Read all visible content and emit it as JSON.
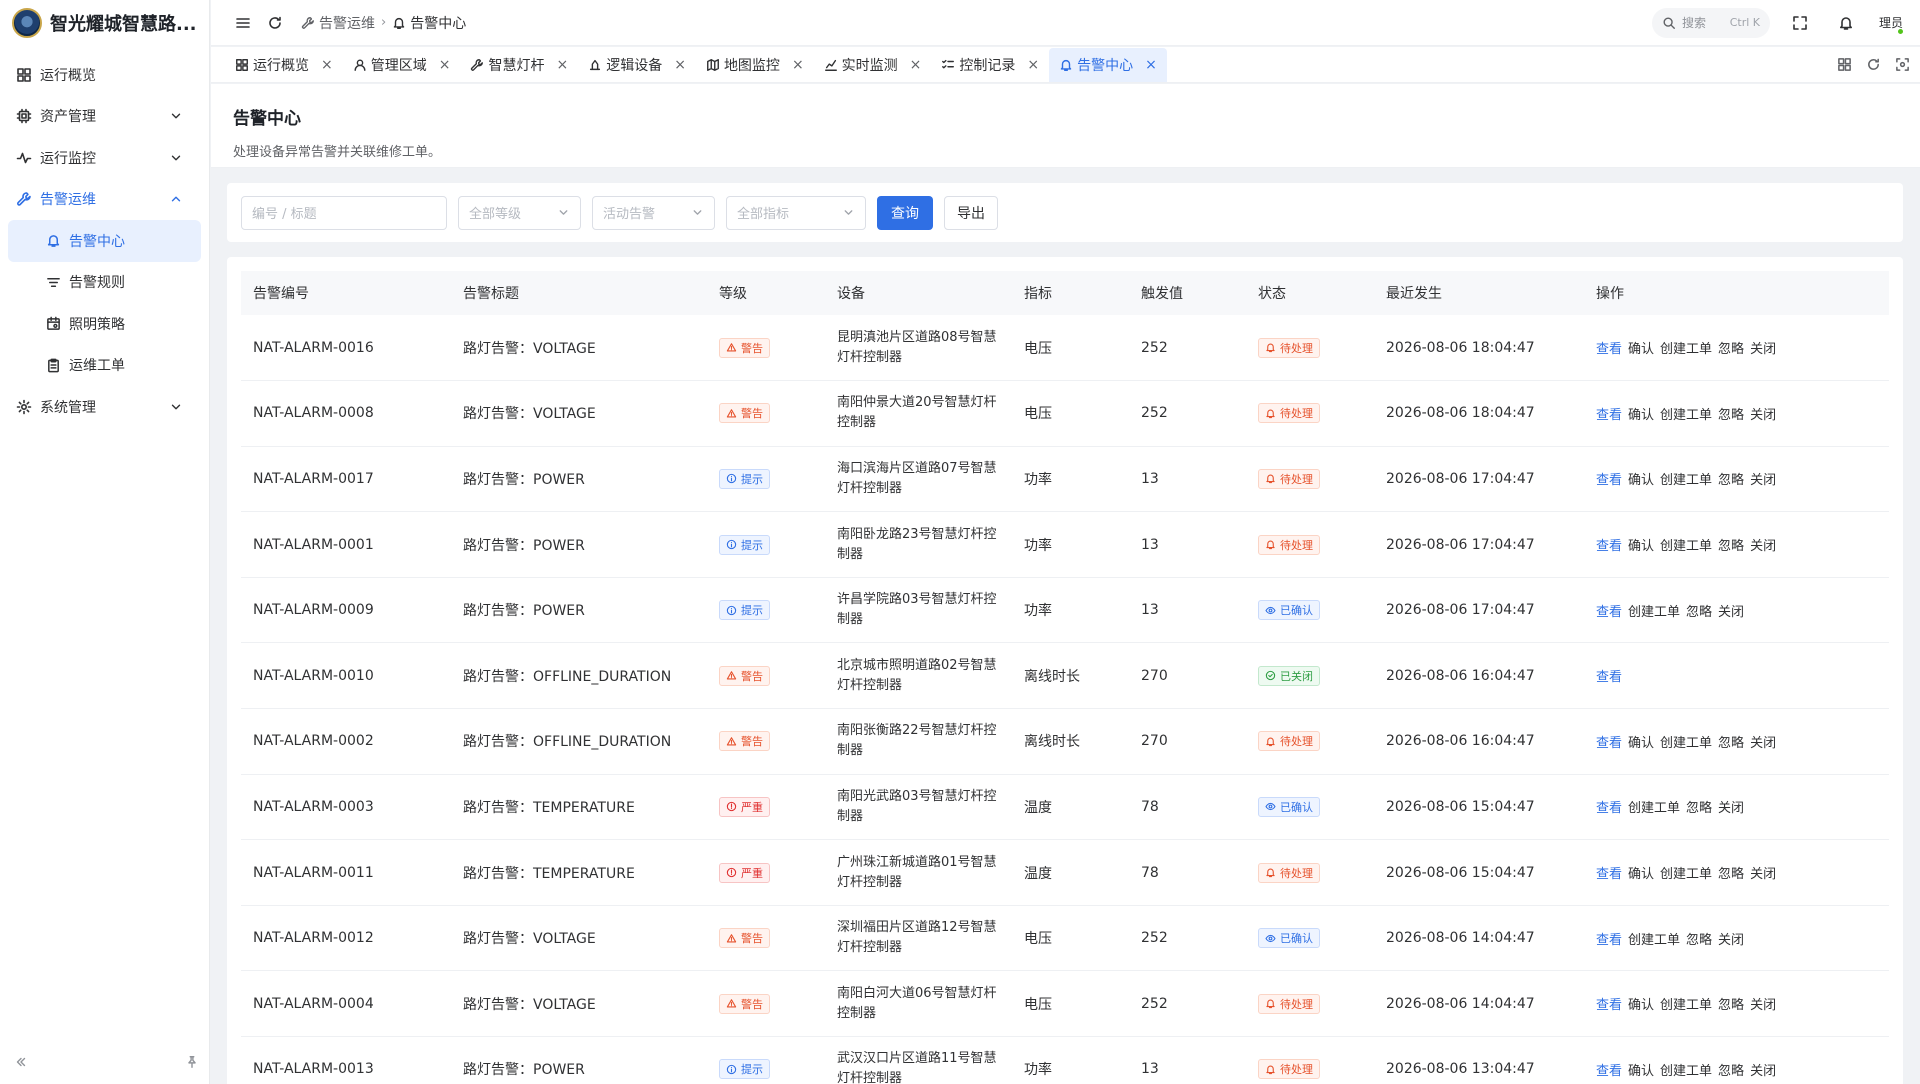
{
  "app": {
    "title": "智光耀城智慧路..."
  },
  "sidebar": {
    "items": [
      {
        "label": "运行概览",
        "icon": "grid-icon"
      },
      {
        "label": "资产管理",
        "icon": "cpu-icon"
      },
      {
        "label": "运行监控",
        "icon": "activity-icon"
      },
      {
        "label": "告警运维",
        "icon": "wrench-icon"
      },
      {
        "label": "系统管理",
        "icon": "settings-icon"
      }
    ],
    "subitems": [
      {
        "label": "告警中心",
        "icon": "bell-icon"
      },
      {
        "label": "告警规则",
        "icon": "filter-icon"
      },
      {
        "label": "照明策略",
        "icon": "calendar-icon"
      },
      {
        "label": "运维工单",
        "icon": "clipboard-icon"
      }
    ]
  },
  "header": {
    "breadcrumb": [
      "告警运维",
      "告警中心"
    ],
    "search_label": "搜索",
    "search_kbd": "Ctrl K",
    "user": "理员"
  },
  "tabs": [
    "运行概览",
    "管理区域",
    "智慧灯杆",
    "逻辑设备",
    "地图监控",
    "实时监测",
    "控制记录",
    "告警中心"
  ],
  "page": {
    "title": "告警中心",
    "subtitle": "处理设备异常告警并关联维修工单。"
  },
  "filters": {
    "keyword_placeholder": "编号 / 标题",
    "level": "全部等级",
    "status": "活动告警",
    "metric": "全部指标",
    "query_label": "查询",
    "export_label": "导出"
  },
  "table": {
    "columns": [
      "告警编号",
      "告警标题",
      "等级",
      "设备",
      "指标",
      "触发值",
      "状态",
      "最近发生",
      "操作"
    ],
    "rows": [
      {
        "id": "NAT-ALARM-0016",
        "title": "路灯告警：VOLTAGE",
        "level": "警告",
        "level_type": "warn",
        "device": "昆明滇池片区道路08号智慧灯杆控制器",
        "metric": "电压",
        "value": "252",
        "status": "待处理",
        "status_type": "pend",
        "time": "2026-08-06 18:04:47",
        "ops": [
          "查看",
          "确认",
          "创建工单",
          "忽略",
          "关闭"
        ]
      },
      {
        "id": "NAT-ALARM-0008",
        "title": "路灯告警：VOLTAGE",
        "level": "警告",
        "level_type": "warn",
        "device": "南阳仲景大道20号智慧灯杆控制器",
        "metric": "电压",
        "value": "252",
        "status": "待处理",
        "status_type": "pend",
        "time": "2026-08-06 18:04:47",
        "ops": [
          "查看",
          "确认",
          "创建工单",
          "忽略",
          "关闭"
        ]
      },
      {
        "id": "NAT-ALARM-0017",
        "title": "路灯告警：POWER",
        "level": "提示",
        "level_type": "info",
        "device": "海口滨海片区道路07号智慧灯杆控制器",
        "metric": "功率",
        "value": "13",
        "status": "待处理",
        "status_type": "pend",
        "time": "2026-08-06 17:04:47",
        "ops": [
          "查看",
          "确认",
          "创建工单",
          "忽略",
          "关闭"
        ]
      },
      {
        "id": "NAT-ALARM-0001",
        "title": "路灯告警：POWER",
        "level": "提示",
        "level_type": "info",
        "device": "南阳卧龙路23号智慧灯杆控制器",
        "metric": "功率",
        "value": "13",
        "status": "待处理",
        "status_type": "pend",
        "time": "2026-08-06 17:04:47",
        "ops": [
          "查看",
          "确认",
          "创建工单",
          "忽略",
          "关闭"
        ]
      },
      {
        "id": "NAT-ALARM-0009",
        "title": "路灯告警：POWER",
        "level": "提示",
        "level_type": "info",
        "device": "许昌学院路03号智慧灯杆控制器",
        "metric": "功率",
        "value": "13",
        "status": "已确认",
        "status_type": "ack",
        "time": "2026-08-06 17:04:47",
        "ops": [
          "查看",
          "创建工单",
          "忽略",
          "关闭"
        ]
      },
      {
        "id": "NAT-ALARM-0010",
        "title": "路灯告警：OFFLINE_DURATION",
        "level": "警告",
        "level_type": "warn",
        "device": "北京城市照明道路02号智慧灯杆控制器",
        "metric": "离线时长",
        "value": "270",
        "status": "已关闭",
        "status_type": "closed",
        "time": "2026-08-06 16:04:47",
        "ops": [
          "查看"
        ]
      },
      {
        "id": "NAT-ALARM-0002",
        "title": "路灯告警：OFFLINE_DURATION",
        "level": "警告",
        "level_type": "warn",
        "device": "南阳张衡路22号智慧灯杆控制器",
        "metric": "离线时长",
        "value": "270",
        "status": "待处理",
        "status_type": "pend",
        "time": "2026-08-06 16:04:47",
        "ops": [
          "查看",
          "确认",
          "创建工单",
          "忽略",
          "关闭"
        ]
      },
      {
        "id": "NAT-ALARM-0003",
        "title": "路灯告警：TEMPERATURE",
        "level": "严重",
        "level_type": "crit",
        "device": "南阳光武路03号智慧灯杆控制器",
        "metric": "温度",
        "value": "78",
        "status": "已确认",
        "status_type": "ack",
        "time": "2026-08-06 15:04:47",
        "ops": [
          "查看",
          "创建工单",
          "忽略",
          "关闭"
        ]
      },
      {
        "id": "NAT-ALARM-0011",
        "title": "路灯告警：TEMPERATURE",
        "level": "严重",
        "level_type": "crit",
        "device": "广州珠江新城道路01号智慧灯杆控制器",
        "metric": "温度",
        "value": "78",
        "status": "待处理",
        "status_type": "pend",
        "time": "2026-08-06 15:04:47",
        "ops": [
          "查看",
          "确认",
          "创建工单",
          "忽略",
          "关闭"
        ]
      },
      {
        "id": "NAT-ALARM-0012",
        "title": "路灯告警：VOLTAGE",
        "level": "警告",
        "level_type": "warn",
        "device": "深圳福田片区道路12号智慧灯杆控制器",
        "metric": "电压",
        "value": "252",
        "status": "已确认",
        "status_type": "ack",
        "time": "2026-08-06 14:04:47",
        "ops": [
          "查看",
          "创建工单",
          "忽略",
          "关闭"
        ]
      },
      {
        "id": "NAT-ALARM-0004",
        "title": "路灯告警：VOLTAGE",
        "level": "警告",
        "level_type": "warn",
        "device": "南阳白河大道06号智慧灯杆控制器",
        "metric": "电压",
        "value": "252",
        "status": "待处理",
        "status_type": "pend",
        "time": "2026-08-06 14:04:47",
        "ops": [
          "查看",
          "确认",
          "创建工单",
          "忽略",
          "关闭"
        ]
      },
      {
        "id": "NAT-ALARM-0013",
        "title": "路灯告警：POWER",
        "level": "提示",
        "level_type": "info",
        "device": "武汉汉口片区道路11号智慧灯杆控制器",
        "metric": "功率",
        "value": "13",
        "status": "待处理",
        "status_type": "pend",
        "time": "2026-08-06 13:04:47",
        "ops": [
          "查看",
          "确认",
          "创建工单",
          "忽略",
          "关闭"
        ]
      }
    ]
  }
}
